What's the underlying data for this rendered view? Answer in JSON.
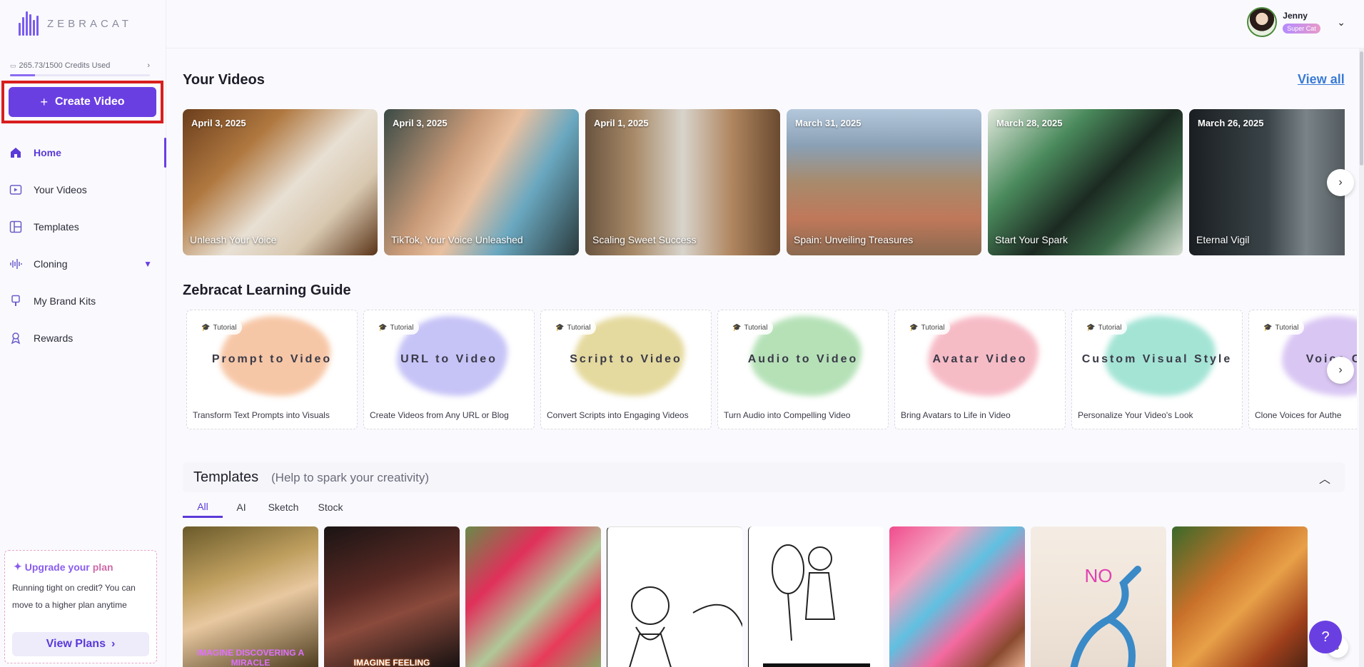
{
  "app": {
    "logo_text": "ZEBRACAT"
  },
  "sidebar": {
    "credits": "265.73/1500 Credits Used",
    "credits_fraction": 0.177,
    "create_label": "Create Video",
    "items": [
      {
        "label": "Home",
        "icon": "home-icon",
        "active": true
      },
      {
        "label": "Your Videos",
        "icon": "video-icon"
      },
      {
        "label": "Templates",
        "icon": "templates-icon"
      },
      {
        "label": "Cloning",
        "icon": "waveform-icon"
      },
      {
        "label": "My Brand Kits",
        "icon": "brush-icon"
      },
      {
        "label": "Rewards",
        "icon": "trophy-icon"
      }
    ],
    "upgrade": {
      "title_a": "Upgrade your",
      "title_b": "plan",
      "desc": "Running tight on credit? You can move to a higher plan anytime",
      "button": "View Plans"
    }
  },
  "user": {
    "name": "Jenny",
    "badge": "Super Cat"
  },
  "videos": {
    "title": "Your Videos",
    "view_all": "View all",
    "items": [
      {
        "date": "April 3, 2025",
        "title": "Unleash Your Voice"
      },
      {
        "date": "April 3, 2025",
        "title": "TikTok, Your Voice Unleashed"
      },
      {
        "date": "April 1, 2025",
        "title": "Scaling Sweet Success"
      },
      {
        "date": "March 31, 2025",
        "title": "Spain: Unveiling Treasures"
      },
      {
        "date": "March 28, 2025",
        "title": "Start Your Spark"
      },
      {
        "date": "March 26, 2025",
        "title": "Eternal Vigil"
      }
    ]
  },
  "guide": {
    "title": "Zebracat Learning Guide",
    "tag": "Tutorial",
    "items": [
      {
        "name": "Prompt to Video",
        "desc": "Transform Text Prompts into Visuals",
        "color": "#f4b58a"
      },
      {
        "name": "URL to Video",
        "desc": "Create Videos from Any URL or Blog",
        "color": "#b4b0f4"
      },
      {
        "name": "Script to Video",
        "desc": "Convert Scripts into Engaging Videos",
        "color": "#dccd7e"
      },
      {
        "name": "Audio to Video",
        "desc": "Turn Audio into Compelling Video",
        "color": "#9ed8a0"
      },
      {
        "name": "Avatar Video",
        "desc": "Bring Avatars to Life in Video",
        "color": "#f4a6b4"
      },
      {
        "name": "Custom Visual Style",
        "desc": "Personalize Your Video's Look",
        "color": "#86dcc8"
      },
      {
        "name": "Voice C",
        "desc": "Clone Voices for Authe",
        "color": "#cdb4f0"
      }
    ]
  },
  "templates": {
    "title": "Templates",
    "subtitle": "(Help to spark your creativity)",
    "tabs": [
      "All",
      "AI",
      "Sketch",
      "Stock"
    ],
    "captions": [
      "IMAGINE DISCOVERING A MIRACLE",
      "IMAGINE FEELING",
      "",
      "",
      "",
      "",
      "NO",
      ""
    ]
  }
}
